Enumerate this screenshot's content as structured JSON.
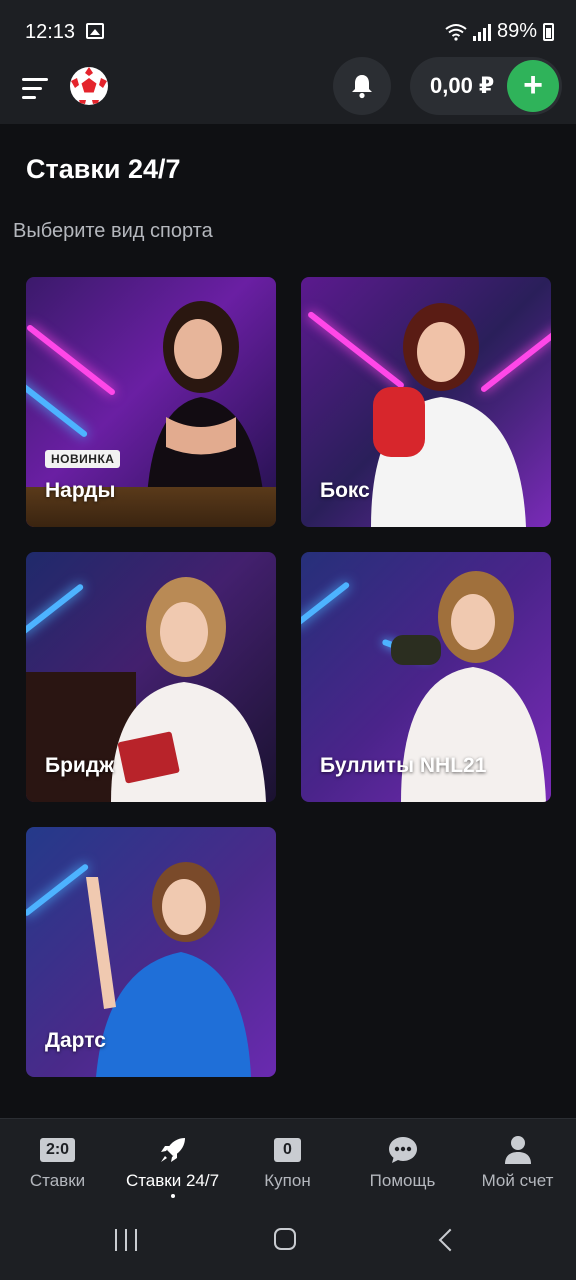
{
  "status_bar": {
    "time": "12:13",
    "battery": "89%"
  },
  "header": {
    "balance": "0,00 ₽",
    "add_label": "+"
  },
  "page": {
    "title": "Ставки 24/7",
    "subtitle": "Выберите вид спорта"
  },
  "sports": [
    {
      "label": "Нарды",
      "badge": "НОВИНКА"
    },
    {
      "label": "Бокс"
    },
    {
      "label": "Бридж"
    },
    {
      "label": "Буллиты NHL21"
    },
    {
      "label": "Дартс"
    }
  ],
  "bottom_nav": {
    "items": [
      {
        "label": "Ставки",
        "icon_text": "2:0",
        "icon": "score-icon"
      },
      {
        "label": "Ставки 24/7",
        "icon": "rocket-icon",
        "active": true
      },
      {
        "label": "Купон",
        "icon_text": "0",
        "icon": "coupon-icon"
      },
      {
        "label": "Помощь",
        "icon": "chat-icon"
      },
      {
        "label": "Мой счет",
        "icon": "user-icon"
      }
    ]
  },
  "colors": {
    "background": "#0f1013",
    "header": "#1d1f23",
    "accent_green": "#2fb35a",
    "neon_pink": "#ff3ce8",
    "neon_blue": "#3aa8ff"
  }
}
